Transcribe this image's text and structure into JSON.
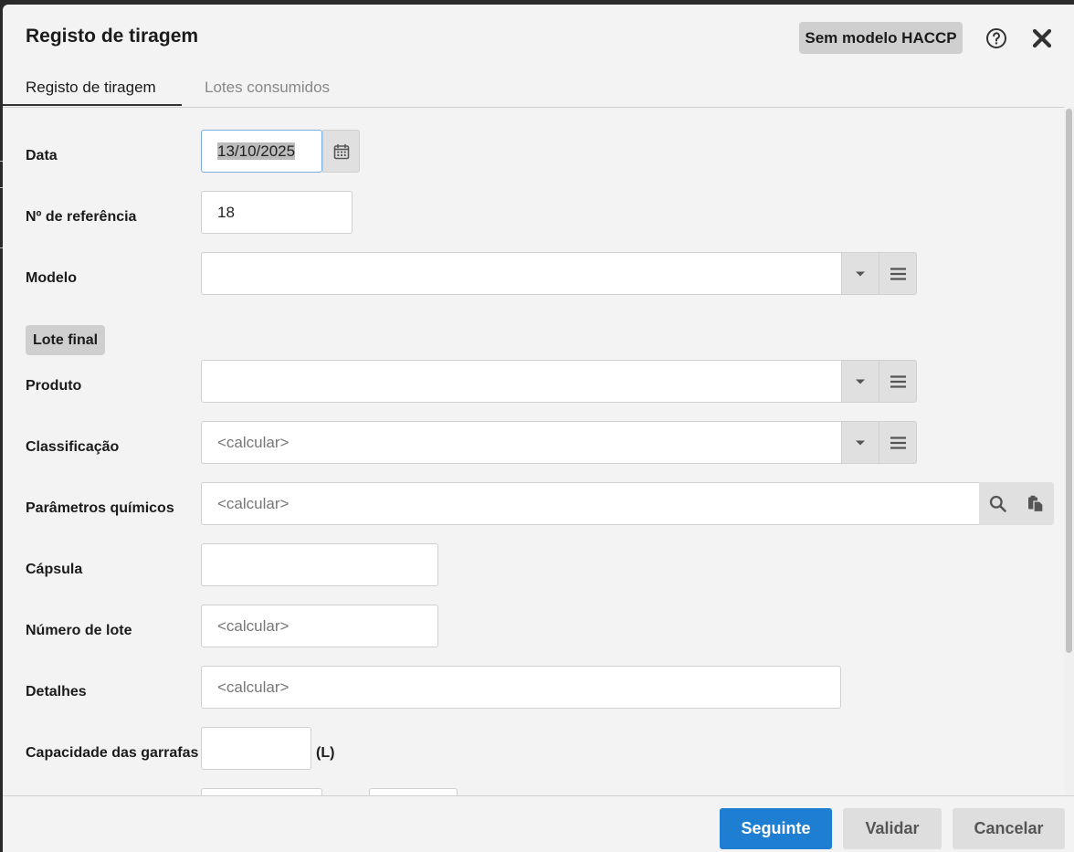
{
  "dialog": {
    "title": "Registo de tiragem",
    "haccp_badge": "Sem modelo HACCP",
    "help_icon": "help-circle-icon",
    "close_icon": "close-icon"
  },
  "tabs": [
    {
      "label": "Registo de tiragem",
      "active": true
    },
    {
      "label": "Lotes consumidos",
      "active": false
    }
  ],
  "form": {
    "data": {
      "label": "Data",
      "value": "13/10/2025",
      "icon": "calendar-icon"
    },
    "referencia": {
      "label": "Nº de referência",
      "value": "18"
    },
    "modelo": {
      "label": "Modelo",
      "value": ""
    },
    "section_lote_final": "Lote final",
    "produto": {
      "label": "Produto",
      "value": ""
    },
    "classificacao": {
      "label": "Classificação",
      "placeholder": "<calcular>"
    },
    "parametros": {
      "label": "Parâmetros químicos",
      "placeholder": "<calcular>"
    },
    "capsula": {
      "label": "Cápsula",
      "value": ""
    },
    "numero_lote": {
      "label": "Número de lote",
      "placeholder": "<calcular>"
    },
    "detalhes": {
      "label": "Detalhes",
      "placeholder": "<calcular>"
    },
    "capacidade": {
      "label": "Capacidade das garrafas",
      "value": "",
      "unit": "(L)"
    }
  },
  "footer": {
    "next_label": "Seguinte",
    "validate_label": "Validar",
    "cancel_label": "Cancelar"
  },
  "colors": {
    "primary": "#1e7fd2",
    "badge_bg": "#cfcfcf",
    "dialog_bg": "#f3f3f3"
  }
}
